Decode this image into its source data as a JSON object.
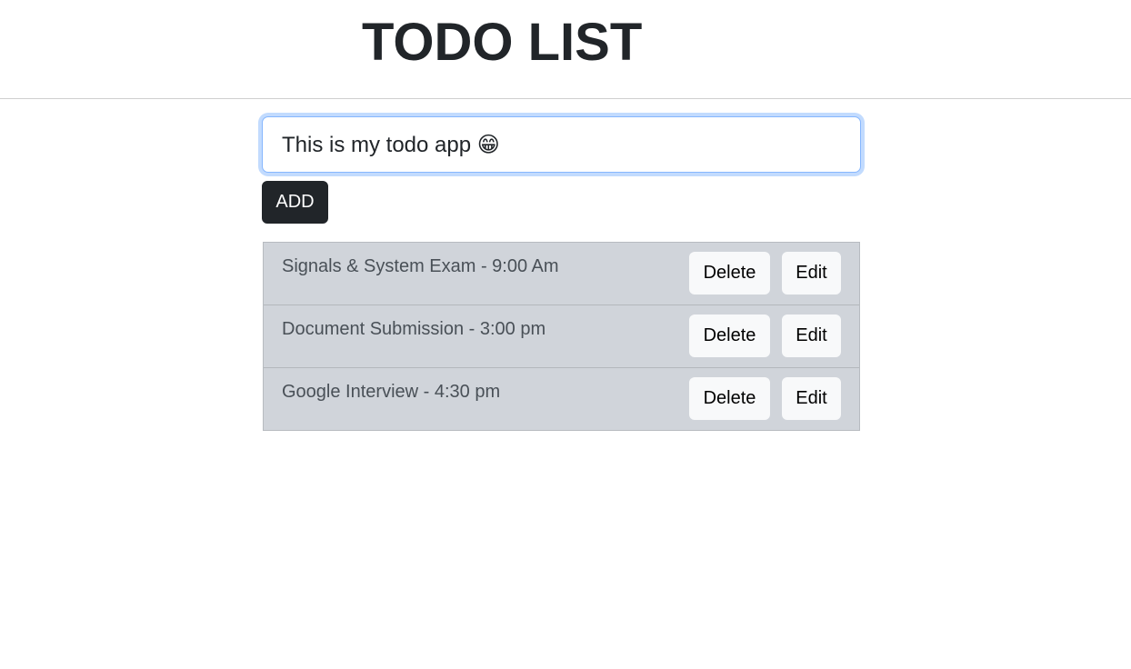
{
  "header": {
    "title": "TODO LIST"
  },
  "input": {
    "value": "This is my todo app 😁"
  },
  "add_button": {
    "label": "ADD"
  },
  "todos": [
    {
      "text": "Signals & System Exam - 9:00 Am",
      "delete_label": "Delete",
      "edit_label": "Edit"
    },
    {
      "text": "Document Submission - 3:00 pm",
      "delete_label": "Delete",
      "edit_label": "Edit"
    },
    {
      "text": "Google Interview - 4:30 pm",
      "delete_label": "Delete",
      "edit_label": "Edit"
    }
  ],
  "colors": {
    "primary_dark": "#212529",
    "list_background": "#d0d4da",
    "button_light": "#f8f9fa",
    "focus_ring": "#86b7fe"
  }
}
